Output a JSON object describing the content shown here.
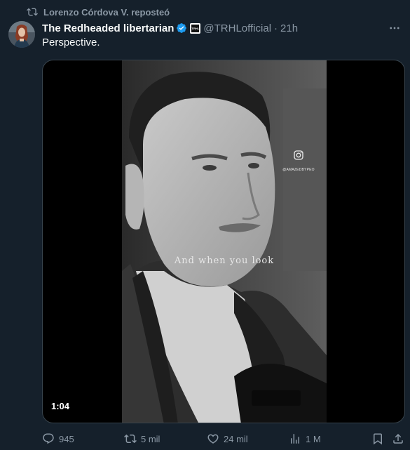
{
  "repost": {
    "text": "Lorenzo Córdova V. reposteó",
    "icon": "repost-icon"
  },
  "author": {
    "display_name": "The Redheaded libertarian",
    "verified": true,
    "affiliate_badge_text": "TRHL",
    "handle": "@TRHLofficial",
    "separator": "·",
    "time": "21h"
  },
  "tweet": {
    "text": "Perspective."
  },
  "video": {
    "caption": "And when you look",
    "watermark": "@AMAZEDBYPEO",
    "duration": "1:04"
  },
  "actions": {
    "replies": "945",
    "reposts": "5 mil",
    "likes": "24 mil",
    "views": "1 M"
  },
  "colors": {
    "background": "#15202b",
    "text": "#f7f9f9",
    "secondary": "#8b98a5",
    "verified": "#1d9bf0",
    "border": "#38444d"
  }
}
